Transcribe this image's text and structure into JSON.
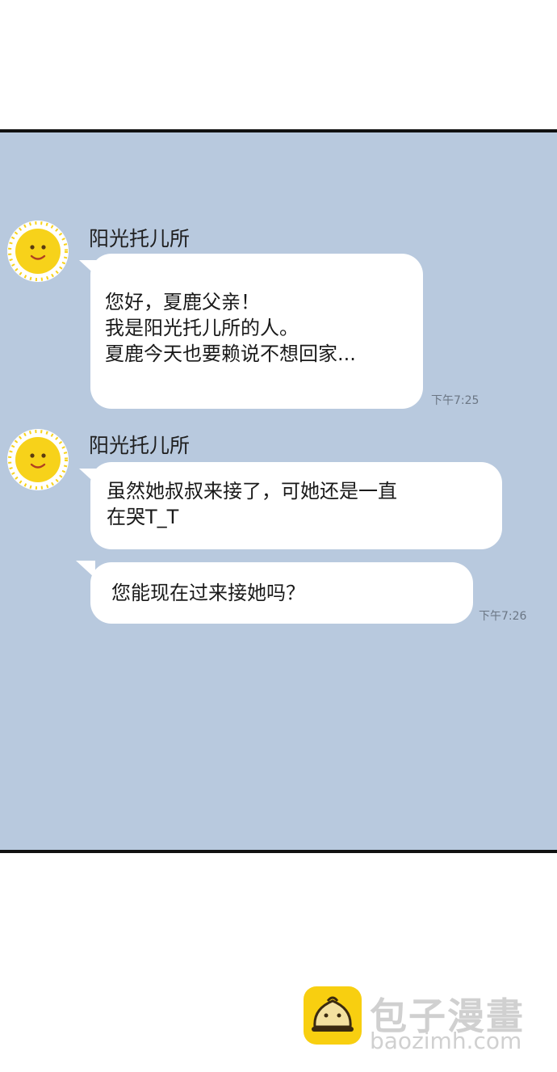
{
  "messages": [
    {
      "sender": "阳光托儿所",
      "lines": [
        "您好，夏鹿父亲！",
        "我是阳光托儿所的人。",
        "夏鹿今天也要赖说不想回家..."
      ],
      "time": "下午7:25"
    },
    {
      "sender": "阳光托儿所",
      "lines": [
        "虽然她叔叔来接了，可她还是一直",
        "在哭T_T"
      ]
    },
    {
      "lines": [
        "您能现在过来接她吗？"
      ],
      "time": "下午7:26"
    }
  ],
  "colors": {
    "chat_background": "#b8c9de",
    "bubble": "#ffffff",
    "avatar_sun": "#f7d21a"
  },
  "watermark": {
    "title": "包子漫畫",
    "site": "baozimh.com",
    "icon": "bun-logo-icon"
  }
}
